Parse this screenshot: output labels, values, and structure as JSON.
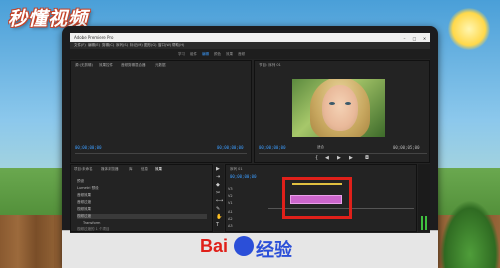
{
  "watermark": {
    "site_logo": "秒懂视频"
  },
  "window": {
    "title": "Adobe Premiere Pro",
    "controls": [
      "–",
      "□",
      "✕"
    ]
  },
  "menu": [
    "文件(F)",
    "编辑(E)",
    "剪辑(C)",
    "序列(S)",
    "标记(M)",
    "图形(G)",
    "窗口(W)",
    "帮助(H)"
  ],
  "workspaces": [
    {
      "label": "学习",
      "active": false
    },
    {
      "label": "组件",
      "active": false
    },
    {
      "label": "编辑",
      "active": true
    },
    {
      "label": "颜色",
      "active": false
    },
    {
      "label": "效果",
      "active": false
    },
    {
      "label": "音频",
      "active": false
    }
  ],
  "source_panel": {
    "tabs": [
      "源:(无剪辑)",
      "效果控件",
      "音频剪辑混合器",
      "元数据"
    ],
    "timecode_left": "00;00;00;00",
    "timecode_right": "00;00;00;00"
  },
  "program_panel": {
    "tab": "节目: 序列 01",
    "timecode_left": "00;00;00;00",
    "fit": "适合",
    "timecode_right": "00;00;05;00"
  },
  "project_panel": {
    "tabs": [
      "项目:未命名",
      "媒体浏览器",
      "库",
      "信息",
      "效果"
    ],
    "rows": [
      "预设",
      "Lumetri 预设",
      "音频效果",
      "音频过渡",
      "视频效果",
      "视频过渡",
      "Transform"
    ],
    "footer": "视频过渡的 1 个项目"
  },
  "tools": [
    "▶",
    "⇥",
    "◆",
    "✂",
    "⟷",
    "✎",
    "✋",
    "T"
  ],
  "timeline": {
    "tab": "序列 01",
    "timecode": "00;00;00;00",
    "tracks": [
      "V3",
      "V2",
      "V1",
      "A1",
      "A2",
      "A3"
    ]
  },
  "footer_brand": {
    "part1": "Bai",
    "part2": "经验"
  }
}
